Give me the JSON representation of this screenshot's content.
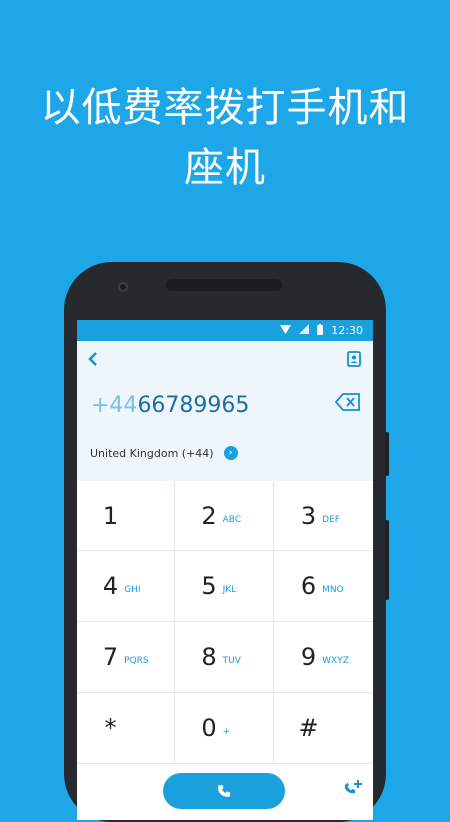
{
  "promo": {
    "headline_line1": "以低费率拨打手机和",
    "headline_line2": "座机"
  },
  "status_bar": {
    "time": "12:30",
    "wifi_icon": "wifi-icon",
    "signal_icon": "signal-icon",
    "battery_icon": "battery-icon"
  },
  "dialer": {
    "number_prefix": "+44",
    "number_digits": "66789965",
    "country_label": "United Kingdom (+44)",
    "keys": [
      {
        "digit": "1",
        "letters": ""
      },
      {
        "digit": "2",
        "letters": "ABC"
      },
      {
        "digit": "3",
        "letters": "DEF"
      },
      {
        "digit": "4",
        "letters": "GHI"
      },
      {
        "digit": "5",
        "letters": "JKL"
      },
      {
        "digit": "6",
        "letters": "MNO"
      },
      {
        "digit": "7",
        "letters": "PQRS"
      },
      {
        "digit": "8",
        "letters": "TUV"
      },
      {
        "digit": "9",
        "letters": "WXYZ"
      },
      {
        "digit": "*",
        "letters": ""
      },
      {
        "digit": "0",
        "letters": "+"
      },
      {
        "digit": "#",
        "letters": ""
      }
    ]
  },
  "colors": {
    "background": "#1ea7e8",
    "accent": "#1aa0dc",
    "panel": "#eef5fb"
  }
}
